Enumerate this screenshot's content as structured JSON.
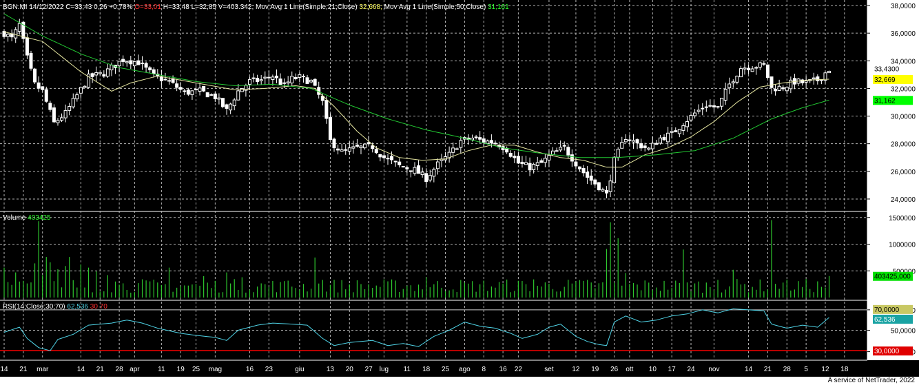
{
  "header": {
    "symbol": "BGN.MI",
    "date": "14/12/2022",
    "close": "C=33,43",
    "change": "0,26 +0,78%",
    "open": "O=33,01",
    "hlv": "H=33,48 L=32,85 V=403.342;",
    "ma21_label": "Mov Avg 1 Line(Simple;21;Close)",
    "ma21_value": "32,668;",
    "ma50_label": "Mov Avg 1 Line(Simple;50;Close)",
    "ma50_value": "31,161"
  },
  "volume_header": {
    "label": "Volume",
    "value": "403425"
  },
  "rsi_header": {
    "label": "RSI(14;Close;30;70)",
    "value": "62,536",
    "low": "30",
    "high": "70"
  },
  "footer": "A service of NetTrader, 2022",
  "colors": {
    "background": "#000000",
    "grid": "#b4b4b4",
    "candle": "#ffffff",
    "ma21": "#e6e6a0",
    "ma50": "#22c832",
    "volume": "#2ec82e",
    "rsi": "#4fd3e6",
    "rsi_high": "#d0d0d0",
    "rsi_low": "#ff0000",
    "axis_bg": "#ffffff"
  },
  "chart_data": {
    "type": "line",
    "x_ticks": [
      {
        "label": "14",
        "i": 0
      },
      {
        "label": "21",
        "i": 5
      },
      {
        "label": "mar",
        "i": 10
      },
      {
        "label": "14",
        "i": 20
      },
      {
        "label": "21",
        "i": 25
      },
      {
        "label": "28",
        "i": 30
      },
      {
        "label": "apr",
        "i": 34
      },
      {
        "label": "11",
        "i": 41
      },
      {
        "label": "19",
        "i": 46
      },
      {
        "label": "25",
        "i": 50
      },
      {
        "label": "mag",
        "i": 55
      },
      {
        "label": "16",
        "i": 64
      },
      {
        "label": "23",
        "i": 69
      },
      {
        "label": "giu",
        "i": 77
      },
      {
        "label": "13",
        "i": 85
      },
      {
        "label": "20",
        "i": 90
      },
      {
        "label": "27",
        "i": 95
      },
      {
        "label": "lug",
        "i": 99
      },
      {
        "label": "11",
        "i": 105
      },
      {
        "label": "18",
        "i": 110
      },
      {
        "label": "25",
        "i": 115
      },
      {
        "label": "ago",
        "i": 120
      },
      {
        "label": "8",
        "i": 125
      },
      {
        "label": "16",
        "i": 130
      },
      {
        "label": "22",
        "i": 134
      },
      {
        "label": "set",
        "i": 142
      },
      {
        "label": "12",
        "i": 149
      },
      {
        "label": "19",
        "i": 154
      },
      {
        "label": "26",
        "i": 159
      },
      {
        "label": "ott",
        "i": 163
      },
      {
        "label": "10",
        "i": 169
      },
      {
        "label": "17",
        "i": 174
      },
      {
        "label": "24",
        "i": 179
      },
      {
        "label": "nov",
        "i": 185
      },
      {
        "label": "14",
        "i": 194
      },
      {
        "label": "21",
        "i": 199
      },
      {
        "label": "28",
        "i": 204
      },
      {
        "label": "5",
        "i": 209
      },
      {
        "label": "12",
        "i": 214
      },
      {
        "label": "18",
        "i": 219
      }
    ],
    "price_axis": {
      "ylim": [
        23.2,
        38.4
      ],
      "ticks": [
        "38,0000",
        "36,0000",
        "34,0000",
        "32,0000",
        "30,0000",
        "28,0000",
        "26,0000",
        "24,0000"
      ],
      "tick_values": [
        38,
        36,
        34,
        32,
        30,
        28,
        26,
        24
      ]
    },
    "volume_axis": {
      "ylim": [
        0,
        1600000
      ],
      "ticks": [
        "1500000",
        "1000000",
        "500000"
      ],
      "tick_values": [
        1500000,
        1000000,
        500000
      ]
    },
    "rsi_axis": {
      "ylim": [
        22,
        78
      ],
      "ticks": [
        "70,0000",
        "50,0000",
        "29,0000"
      ],
      "tick_values": [
        70,
        50,
        29
      ]
    },
    "last_values": {
      "close": "33,4300",
      "ma21": "32,669",
      "ma50": "31,162",
      "volume": "403425,000",
      "rsi": "62,536",
      "rsi_high": "70,0000",
      "rsi_low": "30,0000"
    },
    "close_anchors": [
      [
        0,
        36.0
      ],
      [
        2,
        35.6
      ],
      [
        4,
        36.6
      ],
      [
        6,
        34.2
      ],
      [
        8,
        32.3
      ],
      [
        10,
        31.8
      ],
      [
        13,
        29.5
      ],
      [
        16,
        30.2
      ],
      [
        19,
        31.5
      ],
      [
        22,
        32.8
      ],
      [
        26,
        33.1
      ],
      [
        29,
        33.7
      ],
      [
        31,
        34.1
      ],
      [
        35,
        33.9
      ],
      [
        39,
        32.9
      ],
      [
        43,
        32.5
      ],
      [
        47,
        31.7
      ],
      [
        51,
        31.8
      ],
      [
        55,
        31.4
      ],
      [
        58,
        30.4
      ],
      [
        61,
        31.8
      ],
      [
        64,
        32.5
      ],
      [
        67,
        32.6
      ],
      [
        70,
        32.9
      ],
      [
        73,
        32.2
      ],
      [
        75,
        32.7
      ],
      [
        77,
        32.8
      ],
      [
        80,
        32.5
      ],
      [
        83,
        31.0
      ],
      [
        85,
        28.2
      ],
      [
        88,
        27.4
      ],
      [
        92,
        27.7
      ],
      [
        96,
        27.8
      ],
      [
        99,
        27.0
      ],
      [
        103,
        26.4
      ],
      [
        107,
        26.1
      ],
      [
        110,
        25.5
      ],
      [
        113,
        26.5
      ],
      [
        116,
        27.2
      ],
      [
        119,
        28.2
      ],
      [
        122,
        28.4
      ],
      [
        125,
        28.2
      ],
      [
        128,
        28.1
      ],
      [
        131,
        27.6
      ],
      [
        134,
        26.6
      ],
      [
        137,
        26.3
      ],
      [
        140,
        26.6
      ],
      [
        143,
        27.3
      ],
      [
        146,
        27.7
      ],
      [
        149,
        26.6
      ],
      [
        152,
        25.6
      ],
      [
        155,
        24.9
      ],
      [
        157,
        24.3
      ],
      [
        159,
        26.8
      ],
      [
        162,
        28.5
      ],
      [
        165,
        28.0
      ],
      [
        168,
        27.6
      ],
      [
        171,
        28.4
      ],
      [
        174,
        28.7
      ],
      [
        177,
        29.5
      ],
      [
        180,
        30.2
      ],
      [
        183,
        30.8
      ],
      [
        186,
        30.6
      ],
      [
        189,
        32.3
      ],
      [
        192,
        33.5
      ],
      [
        195,
        33.6
      ],
      [
        198,
        33.7
      ],
      [
        200,
        32.0
      ],
      [
        203,
        32.1
      ],
      [
        206,
        32.5
      ],
      [
        209,
        32.4
      ],
      [
        212,
        32.6
      ],
      [
        215,
        33.4
      ]
    ],
    "ma21_anchors": [
      [
        0,
        36.1
      ],
      [
        10,
        35.4
      ],
      [
        20,
        33.2
      ],
      [
        28,
        31.8
      ],
      [
        33,
        32.4
      ],
      [
        40,
        32.9
      ],
      [
        50,
        32.4
      ],
      [
        60,
        31.9
      ],
      [
        68,
        32.0
      ],
      [
        76,
        32.2
      ],
      [
        81,
        32.0
      ],
      [
        86,
        30.7
      ],
      [
        92,
        28.9
      ],
      [
        97,
        27.7
      ],
      [
        103,
        27.0
      ],
      [
        109,
        26.8
      ],
      [
        115,
        26.9
      ],
      [
        121,
        27.5
      ],
      [
        127,
        27.9
      ],
      [
        133,
        27.9
      ],
      [
        139,
        27.4
      ],
      [
        145,
        27.0
      ],
      [
        151,
        26.8
      ],
      [
        157,
        26.3
      ],
      [
        161,
        26.3
      ],
      [
        167,
        27.2
      ],
      [
        173,
        27.7
      ],
      [
        179,
        28.5
      ],
      [
        185,
        29.6
      ],
      [
        191,
        31.0
      ],
      [
        197,
        32.1
      ],
      [
        203,
        32.4
      ],
      [
        209,
        32.6
      ],
      [
        215,
        32.67
      ]
    ],
    "ma50_anchors": [
      [
        0,
        37.4
      ],
      [
        10,
        35.8
      ],
      [
        20,
        34.5
      ],
      [
        30,
        33.5
      ],
      [
        40,
        33.0
      ],
      [
        50,
        32.5
      ],
      [
        60,
        32.2
      ],
      [
        70,
        32.3
      ],
      [
        80,
        32.0
      ],
      [
        90,
        30.8
      ],
      [
        100,
        29.8
      ],
      [
        110,
        29.0
      ],
      [
        120,
        28.4
      ],
      [
        130,
        27.7
      ],
      [
        140,
        27.3
      ],
      [
        150,
        27.0
      ],
      [
        160,
        27.0
      ],
      [
        170,
        27.2
      ],
      [
        180,
        27.5
      ],
      [
        190,
        28.4
      ],
      [
        200,
        29.8
      ],
      [
        208,
        30.6
      ],
      [
        215,
        31.16
      ]
    ],
    "rsi_anchors": [
      [
        0,
        48
      ],
      [
        4,
        53
      ],
      [
        6,
        42
      ],
      [
        9,
        33
      ],
      [
        12,
        30
      ],
      [
        14,
        41
      ],
      [
        18,
        46
      ],
      [
        22,
        55
      ],
      [
        28,
        57
      ],
      [
        32,
        60
      ],
      [
        36,
        57
      ],
      [
        40,
        52
      ],
      [
        46,
        47
      ],
      [
        50,
        45
      ],
      [
        55,
        43
      ],
      [
        58,
        40
      ],
      [
        61,
        50
      ],
      [
        66,
        55
      ],
      [
        70,
        57
      ],
      [
        75,
        56
      ],
      [
        79,
        55
      ],
      [
        83,
        42
      ],
      [
        86,
        35
      ],
      [
        90,
        38
      ],
      [
        96,
        40
      ],
      [
        100,
        35
      ],
      [
        104,
        37
      ],
      [
        108,
        34
      ],
      [
        112,
        44
      ],
      [
        116,
        50
      ],
      [
        120,
        58
      ],
      [
        124,
        54
      ],
      [
        128,
        52
      ],
      [
        132,
        47
      ],
      [
        135,
        42
      ],
      [
        139,
        46
      ],
      [
        142,
        53
      ],
      [
        145,
        56
      ],
      [
        149,
        44
      ],
      [
        152,
        39
      ],
      [
        155,
        36
      ],
      [
        157,
        35
      ],
      [
        159,
        58
      ],
      [
        162,
        64
      ],
      [
        166,
        58
      ],
      [
        170,
        60
      ],
      [
        174,
        64
      ],
      [
        178,
        66
      ],
      [
        182,
        70
      ],
      [
        186,
        67
      ],
      [
        190,
        71
      ],
      [
        194,
        70
      ],
      [
        198,
        69
      ],
      [
        200,
        56
      ],
      [
        204,
        52
      ],
      [
        208,
        55
      ],
      [
        212,
        53
      ],
      [
        215,
        62.5
      ]
    ],
    "volume_spikes": [
      {
        "i": 0,
        "v": 560000
      },
      {
        "i": 3,
        "v": 470000
      },
      {
        "i": 8,
        "v": 640000
      },
      {
        "i": 9,
        "v": 1430000
      },
      {
        "i": 10,
        "v": 420000
      },
      {
        "i": 11,
        "v": 760000
      },
      {
        "i": 12,
        "v": 660000
      },
      {
        "i": 14,
        "v": 530000
      },
      {
        "i": 16,
        "v": 590000
      },
      {
        "i": 17,
        "v": 760000
      },
      {
        "i": 20,
        "v": 620000
      },
      {
        "i": 22,
        "v": 560000
      },
      {
        "i": 24,
        "v": 490000
      },
      {
        "i": 27,
        "v": 420000
      },
      {
        "i": 29,
        "v": 300000
      },
      {
        "i": 43,
        "v": 560000
      },
      {
        "i": 52,
        "v": 400000
      },
      {
        "i": 58,
        "v": 470000
      },
      {
        "i": 62,
        "v": 380000
      },
      {
        "i": 72,
        "v": 290000
      },
      {
        "i": 81,
        "v": 750000
      },
      {
        "i": 83,
        "v": 330000
      },
      {
        "i": 110,
        "v": 380000
      },
      {
        "i": 138,
        "v": 340000
      },
      {
        "i": 152,
        "v": 330000
      },
      {
        "i": 157,
        "v": 910000
      },
      {
        "i": 158,
        "v": 1410000
      },
      {
        "i": 160,
        "v": 1110000
      },
      {
        "i": 162,
        "v": 460000
      },
      {
        "i": 177,
        "v": 900000
      },
      {
        "i": 186,
        "v": 330000
      },
      {
        "i": 190,
        "v": 520000
      },
      {
        "i": 200,
        "v": 1450000
      },
      {
        "i": 203,
        "v": 280000
      },
      {
        "i": 215,
        "v": 403425
      }
    ]
  }
}
